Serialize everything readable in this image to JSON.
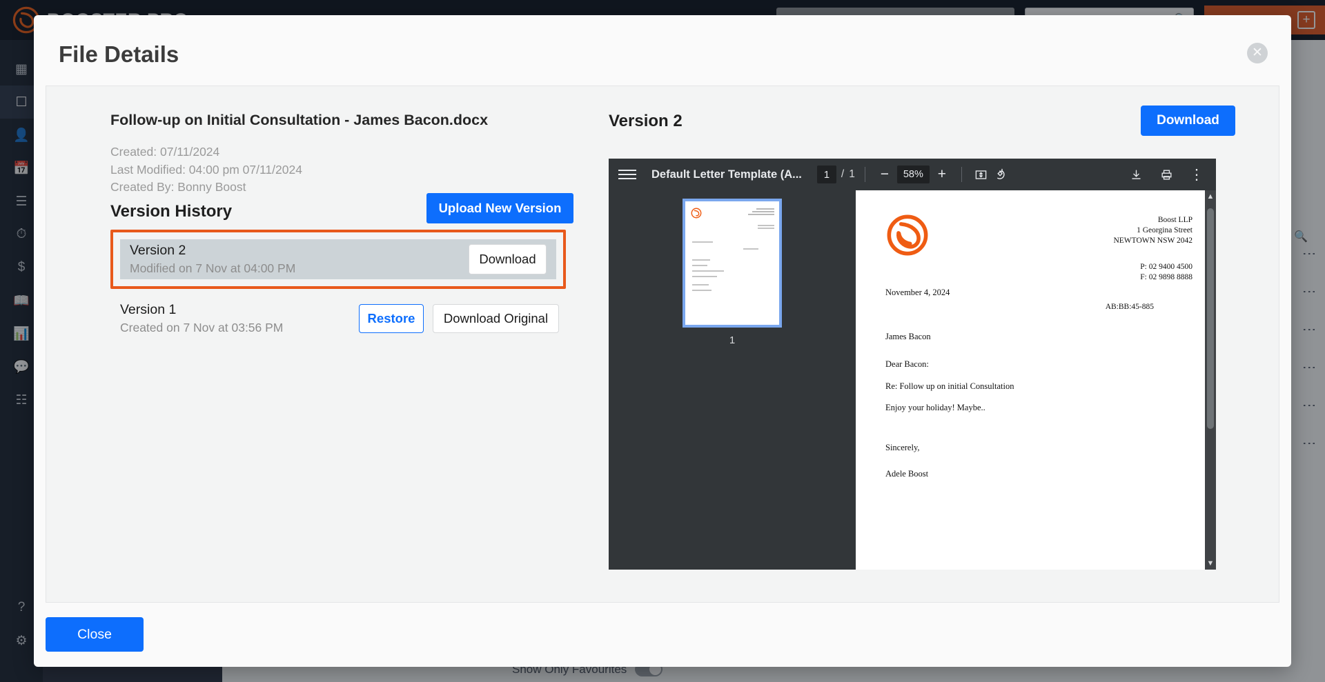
{
  "app": {
    "brand_name": "BOOSTER PRO",
    "add_button_icon": "plus-icon",
    "favourites_toggle_label": "Show Only Favourites",
    "sidebar_icons": [
      "dashboard-icon",
      "matters-icon",
      "contacts-icon",
      "calendar-icon",
      "tasks-icon",
      "time-icon",
      "billing-icon",
      "library-icon",
      "reports-icon",
      "messages-icon",
      "apps-icon"
    ],
    "sidebar_bottom_icons": [
      "help-icon",
      "settings-icon"
    ]
  },
  "modal": {
    "title": "File Details",
    "close_icon": "close-icon",
    "close_label": "Close"
  },
  "file": {
    "name": "Follow-up on Initial Consultation - James Bacon.docx",
    "created_label": "Created: 07/11/2024",
    "last_modified_label": "Last Modified: 04:00 pm 07/11/2024",
    "created_by_label": "Created By: Bonny Boost"
  },
  "version_history": {
    "title": "Version History",
    "upload_button": "Upload New Version",
    "highlight_color": "#e8591b",
    "versions": [
      {
        "name": "Version 2",
        "meta": "Modified on 7 Nov at 04:00 PM",
        "selected": true,
        "actions": [
          "Download"
        ]
      },
      {
        "name": "Version 1",
        "meta": "Created on 7 Nov at 03:56 PM",
        "selected": false,
        "actions": [
          "Restore",
          "Download Original"
        ]
      }
    ],
    "v2_download_label": "Download",
    "v1_restore_label": "Restore",
    "v1_download_original_label": "Download Original"
  },
  "preview": {
    "heading": "Version 2",
    "download_label": "Download",
    "toolbar": {
      "menu_icon": "hamburger-menu-icon",
      "doc_title": "Default Letter Template (A...",
      "page_current": "1",
      "page_separator": "/",
      "page_total": "1",
      "zoom_out_icon": "minus-icon",
      "zoom_level": "58%",
      "zoom_in_icon": "plus-icon",
      "fit_page_icon": "fit-page-icon",
      "rotate_icon": "rotate-icon",
      "download_icon": "download-icon",
      "print_icon": "print-icon",
      "more_icon": "more-vertical-icon"
    },
    "thumbnail_label": "1"
  },
  "document": {
    "logo_icon": "boost-logo-icon",
    "letterhead": [
      "Boost LLP",
      "1 Georgina Street",
      "NEWTOWN NSW 2042"
    ],
    "contact": [
      "P: 02 9400 4500",
      "F: 02 9898 8888"
    ],
    "date": "November 4, 2024",
    "reference": "AB:BB:45-885",
    "recipient": "James Bacon",
    "salutation": "Dear Bacon:",
    "subject": "Re: Follow up on initial Consultation",
    "body": "Enjoy your holiday! Maybe..",
    "closing": "Sincerely,",
    "signer": "Adele Boost"
  },
  "colors": {
    "accent_orange": "#e8591b",
    "brand_orange": "#ef5c13",
    "primary_blue": "#0d6efd",
    "toolbar_dark": "#323639"
  }
}
